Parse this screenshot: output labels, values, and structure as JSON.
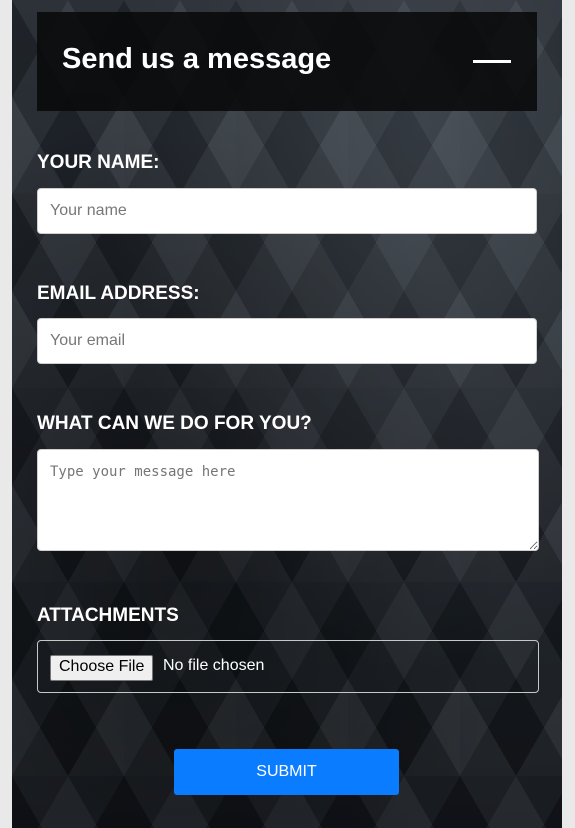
{
  "form": {
    "title": "Send us a message",
    "name": {
      "label": "YOUR NAME:",
      "placeholder": "Your name"
    },
    "email": {
      "label": "EMAIL ADDRESS:",
      "placeholder": "Your email"
    },
    "message": {
      "label": "WHAT CAN WE DO FOR YOU?",
      "placeholder": "Type your message here"
    },
    "attachments": {
      "label": "ATTACHMENTS",
      "button_label": "Choose File",
      "status": "No file chosen"
    },
    "submit_label": "SUBMIT"
  },
  "icons": {
    "collapse": "minus-icon"
  },
  "colors": {
    "submit_bg": "#0a7cff",
    "header_bg": "#08090a",
    "text": "#ffffff"
  }
}
